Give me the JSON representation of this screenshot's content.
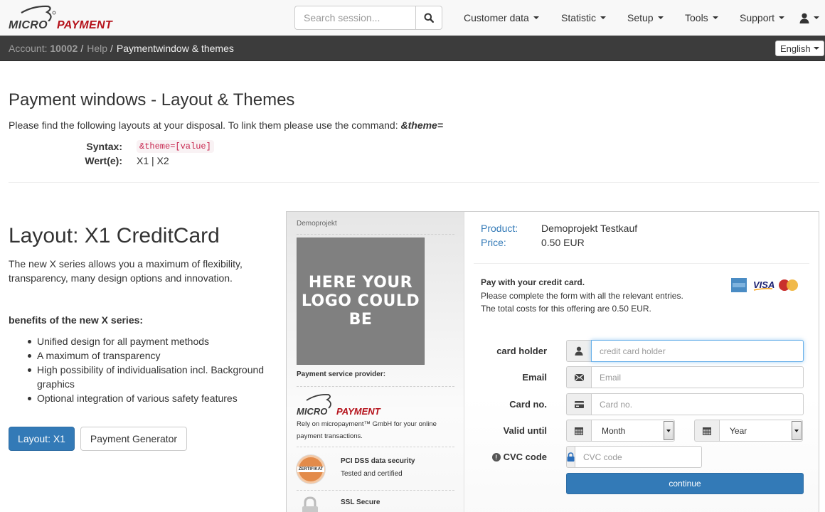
{
  "brand": {
    "part1": "MICRO",
    "part2": "PAYMENT",
    "accent": "#b5121b"
  },
  "search": {
    "placeholder": "Search session...",
    "icon": "search-icon"
  },
  "nav": {
    "items": [
      {
        "label": "Customer data"
      },
      {
        "label": "Statistic"
      },
      {
        "label": "Setup"
      },
      {
        "label": "Tools"
      },
      {
        "label": "Support"
      }
    ],
    "user_icon": "user-icon"
  },
  "breadcrumb": {
    "account_label": "Account:",
    "account_id": "10002",
    "items": [
      "Help",
      "Paymentwindow & themes"
    ],
    "separator": "/"
  },
  "language": {
    "selected": "English"
  },
  "page": {
    "title": "Payment windows - Layout & Themes",
    "intro": "Please find the following layouts at your disposal. To link them please use the command:",
    "intro_command": "&theme=",
    "syntax_label": "Syntax:",
    "syntax_value": "&theme=[value]",
    "values_label": "Wert(e):",
    "values_value": "X1 | X2"
  },
  "layout": {
    "title": "Layout: X1 CreditCard",
    "description": "The new X series allows you a maximum of flexibility, transparency, many design options and innovation.",
    "benefits_title": "benefits of the new X series:",
    "benefits": [
      "Unified design for all payment methods",
      "A maximum of transparency",
      "High possibility of individualisation incl. Background graphics",
      "Optional integration of various safety features"
    ],
    "primary_button": "Layout: X1",
    "secondary_button": "Payment Generator"
  },
  "preview": {
    "project_name": "Demoprojekt",
    "logo_placeholder": "HERE YOUR LOGO COULD BE",
    "psp_label": "Payment service provider:",
    "psp_text": "Rely on micropayment™ GmbH for your online payment transactions.",
    "security": [
      {
        "title": "PCI DSS data security",
        "subtitle": "Tested and certified",
        "badge": "ZERTIFIKAT"
      },
      {
        "title": "SSL Secure",
        "subtitle": ""
      }
    ],
    "product_label": "Product:",
    "product_value": "Demoprojekt Testkauf",
    "price_label": "Price:",
    "price_value": "0.50 EUR",
    "pay_heading": "Pay with your credit card.",
    "pay_line1": "Please complete the form with all the relevant entries.",
    "pay_line2": "The total costs for this offering are 0.50 EUR.",
    "card_brands": [
      "American Express",
      "VISA",
      "MasterCard"
    ],
    "form": {
      "holder_label": "card holder",
      "holder_placeholder": "credit card holder",
      "email_label": "Email",
      "email_placeholder": "Email",
      "cardno_label": "Card no.",
      "cardno_placeholder": "Card no.",
      "valid_label": "Valid until",
      "month_selected": "Month",
      "year_selected": "Year",
      "cvc_label": "CVC code",
      "cvc_placeholder": "CVC code",
      "submit": "continue"
    }
  }
}
